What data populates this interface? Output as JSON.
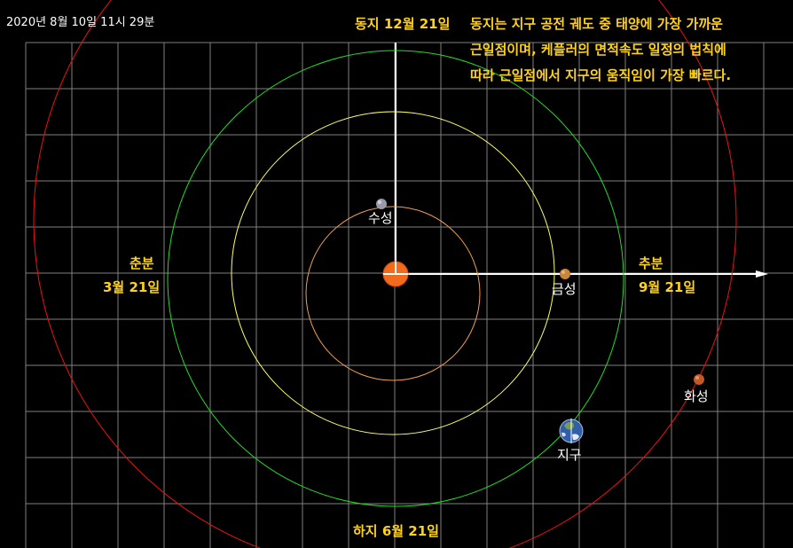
{
  "window": {
    "timestamp": "2020년  8월 10일 11시 29분"
  },
  "season_labels": {
    "winter_solstice": "동지 12월 21일",
    "summer_solstice": "하지 6월 21일",
    "spring_equinox_title": "춘분",
    "spring_equinox_date": "3월 21일",
    "autumn_equinox_title": "추분",
    "autumn_equinox_date": "9월 21일"
  },
  "note": {
    "line1": "동지는 지구 공전 궤도 중 태양에 가장 가까운",
    "line2": "근일점이며, 케플러의 면적속도 일정의 법칙에",
    "line3": "따라 근일점에서 지구의 움직임이 가장 빠르다."
  },
  "bodies": {
    "sun": {
      "icon": "sun-icon",
      "color": "#f26a1b"
    },
    "mercury": {
      "label": "수성",
      "icon": "mercury-icon",
      "orbit_color": "#f0a050"
    },
    "venus": {
      "label": "금성",
      "icon": "venus-icon",
      "orbit_color": "#ffff66"
    },
    "earth": {
      "label": "지구",
      "icon": "earth-icon",
      "orbit_color": "#22dd22"
    },
    "mars": {
      "label": "화성",
      "icon": "mars-icon",
      "orbit_color": "#ee1111"
    }
  },
  "colors": {
    "background": "#000000",
    "grid": "#808080",
    "axis": "#ffffff",
    "accent_text": "#ffd21a"
  }
}
